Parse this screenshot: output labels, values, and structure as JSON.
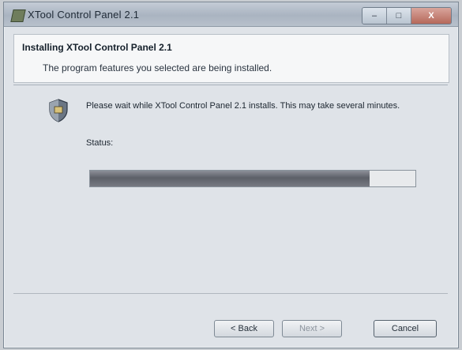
{
  "window": {
    "title": "XTool Control Panel 2.1",
    "caption_close": "X"
  },
  "header": {
    "title": "Installing XTool Control Panel 2.1",
    "subtitle": "The program features you selected are being installed."
  },
  "body": {
    "message": "Please wait while XTool Control Panel 2.1 installs. This may take several minutes.",
    "status_label": "Status:",
    "progress_fraction": 0.86
  },
  "buttons": {
    "back_label": "< Back",
    "next_label": "Next >",
    "cancel_label": "Cancel"
  },
  "colors": {
    "window_bg": "#dfe3e8",
    "progress_fill": "#5d6068"
  },
  "icons": {
    "title": "installer-icon",
    "body": "shield-icon"
  }
}
